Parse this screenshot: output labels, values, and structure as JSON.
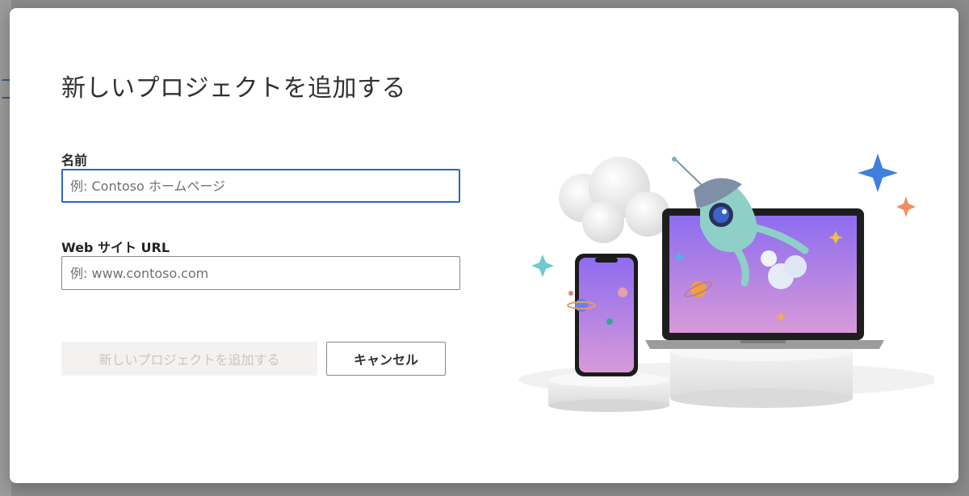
{
  "dialog": {
    "title": "新しいプロジェクトを追加する",
    "name_label": "名前",
    "name_placeholder": "例: Contoso ホームページ",
    "name_value": "",
    "url_label": "Web サイト URL",
    "url_placeholder": "例: www.contoso.com",
    "url_value": "",
    "primary_button": "新しいプロジェクトを追加する",
    "cancel_button": "キャンセル"
  },
  "illustration": {
    "icons": [
      "cloud-icon",
      "laptop-icon",
      "phone-icon",
      "rocket-icon",
      "sparkle-icon",
      "planet-icon"
    ]
  },
  "colors": {
    "focus_border": "#2b68c4",
    "disabled_bg": "#f3f2f1",
    "disabled_text": "#c8c6c4",
    "screen_gradient_top": "#8e6cf0",
    "screen_gradient_bottom": "#d79ad8",
    "sparkle_blue": "#3f7fe0",
    "sparkle_orange": "#f09060"
  }
}
